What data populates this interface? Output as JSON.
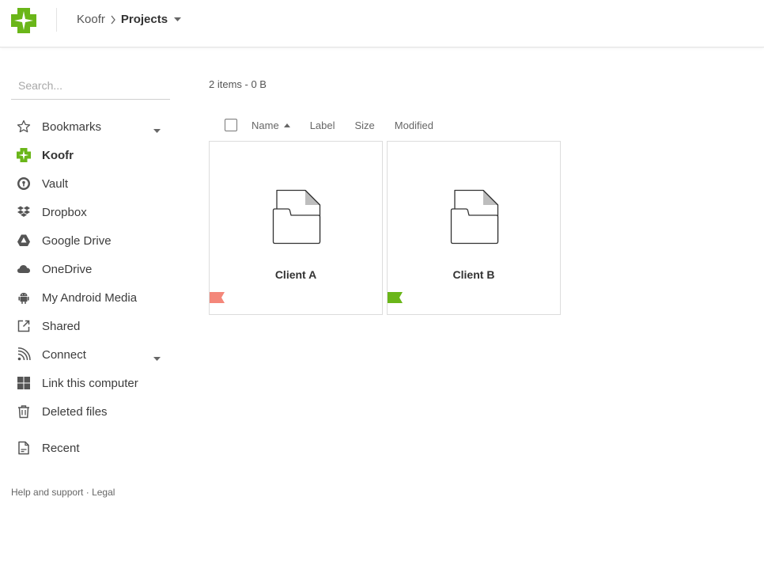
{
  "header": {
    "logo_icon": "koofr-logo-icon",
    "breadcrumb": {
      "root": "Koofr",
      "current": "Projects"
    }
  },
  "sidebar": {
    "search_placeholder": "Search...",
    "items": [
      {
        "label": "Bookmarks",
        "icon": "star-icon",
        "has_dropdown": true
      },
      {
        "label": "Koofr",
        "icon": "koofr-icon",
        "active": true
      },
      {
        "label": "Vault",
        "icon": "vault-icon"
      },
      {
        "label": "Dropbox",
        "icon": "dropbox-icon"
      },
      {
        "label": "Google Drive",
        "icon": "google-drive-icon"
      },
      {
        "label": "OneDrive",
        "icon": "cloud-icon"
      },
      {
        "label": "My Android Media",
        "icon": "android-icon"
      },
      {
        "label": "Shared",
        "icon": "external-link-icon"
      },
      {
        "label": "Connect",
        "icon": "rss-icon",
        "has_dropdown": true
      },
      {
        "label": "Link this computer",
        "icon": "windows-icon"
      },
      {
        "label": "Deleted files",
        "icon": "trash-icon"
      },
      {
        "label": "Recent",
        "icon": "recent-file-icon"
      }
    ],
    "footer": {
      "help": "Help and support",
      "separator": " · ",
      "legal": "Legal"
    }
  },
  "main": {
    "summary": "2 items - 0 B",
    "columns": {
      "name": "Name",
      "label": "Label",
      "size": "Size",
      "modified": "Modified"
    },
    "files": [
      {
        "name": "Client A",
        "icon": "folder-icon",
        "label_color": "#f4877a"
      },
      {
        "name": "Client B",
        "icon": "folder-icon",
        "label_color": "#6ab619"
      }
    ]
  },
  "colors": {
    "brand": "#6ab619",
    "label_red": "#f4877a",
    "label_green": "#6ab619"
  }
}
